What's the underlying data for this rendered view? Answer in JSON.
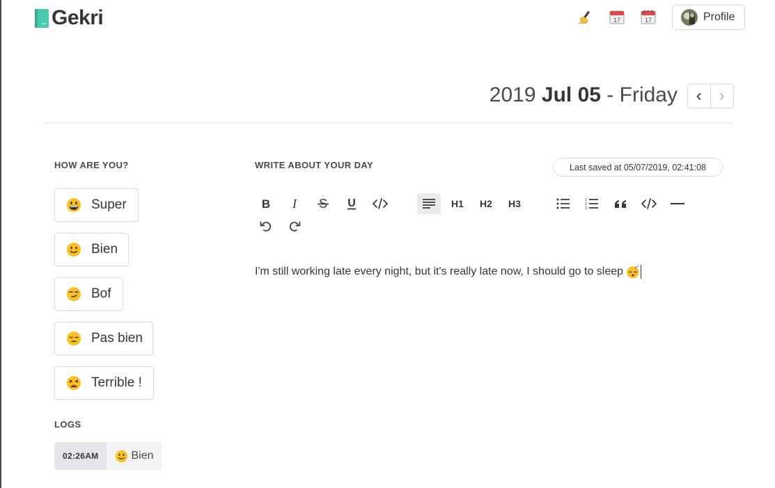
{
  "app": {
    "name": "Gekri"
  },
  "nav": {
    "icons": [
      "writing-hand-icon",
      "calendar-icon",
      "spiral-calendar-icon"
    ],
    "profile_label": "Profile"
  },
  "date": {
    "year": "2019",
    "monthday": "Jul 05",
    "separator": "-",
    "weekday": "Friday",
    "prev_symbol": "‹",
    "next_symbol": "›"
  },
  "mood": {
    "heading": "HOW ARE YOU?",
    "options": [
      {
        "label": "Super",
        "icon": "grinning-face-icon"
      },
      {
        "label": "Bien",
        "icon": "slightly-smiling-face-icon"
      },
      {
        "label": "Bof",
        "icon": "smirking-face-icon"
      },
      {
        "label": "Pas bien",
        "icon": "pensive-face-icon"
      },
      {
        "label": "Terrible !",
        "icon": "weary-face-icon"
      }
    ]
  },
  "logs": {
    "heading": "LOGS",
    "entries": [
      {
        "time": "02:26AM",
        "mood": "Bien",
        "icon": "slightly-smiling-face-icon"
      }
    ]
  },
  "editor": {
    "heading": "WRITE ABOUT YOUR DAY",
    "last_saved": "Last saved at 05/07/2019, 02:41:08",
    "toolbar": {
      "h1": "H1",
      "h2": "H2",
      "h3": "H3",
      "buttons": [
        "bold",
        "italic",
        "strikethrough",
        "underline",
        "code",
        "paragraph",
        "heading-1",
        "heading-2",
        "heading-3",
        "bullet-list",
        "ordered-list",
        "blockquote",
        "code-block",
        "horizontal-rule",
        "undo",
        "redo"
      ],
      "active": "paragraph"
    },
    "content": "I'm still working late every night, but it's really late now, I should go to sleep",
    "content_icon": "sleeping-face-icon"
  },
  "colors": {
    "brand": "#48c9b0",
    "text": "#363636",
    "border": "#dbdbdb",
    "log_time_bg": "#e3e7ec",
    "emoji": "#fcc21b"
  }
}
